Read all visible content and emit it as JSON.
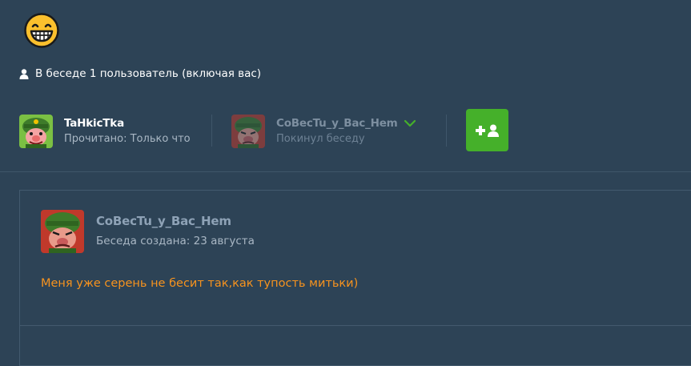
{
  "header": {
    "emoji_icon": "grinning-face-icon",
    "participants_text": "В беседе 1 пользователь (включая вас)"
  },
  "members": [
    {
      "name": "TaHkicTka",
      "status": "Прочитано: Только что",
      "avatar_icon": "tank-soldier-avatar"
    },
    {
      "name": "CoBecTu_y_Bac_Hem",
      "status": "Покинул беседу",
      "avatar_icon": "tank-soldier-avatar",
      "badge_icon": "check-icon"
    }
  ],
  "add_button": {
    "icon": "add-user-icon",
    "color": "#45b02a"
  },
  "conversation": {
    "creator": "CoBecTu_y_Bac_Hem",
    "created": "Беседа создана: 23 августа",
    "message": "Меня уже серень не бесит так,как тупость митьки)",
    "message_color": "#f7931e"
  },
  "colors": {
    "background": "#2d4356",
    "divider": "#3f566a",
    "accent": "#45b02a"
  }
}
